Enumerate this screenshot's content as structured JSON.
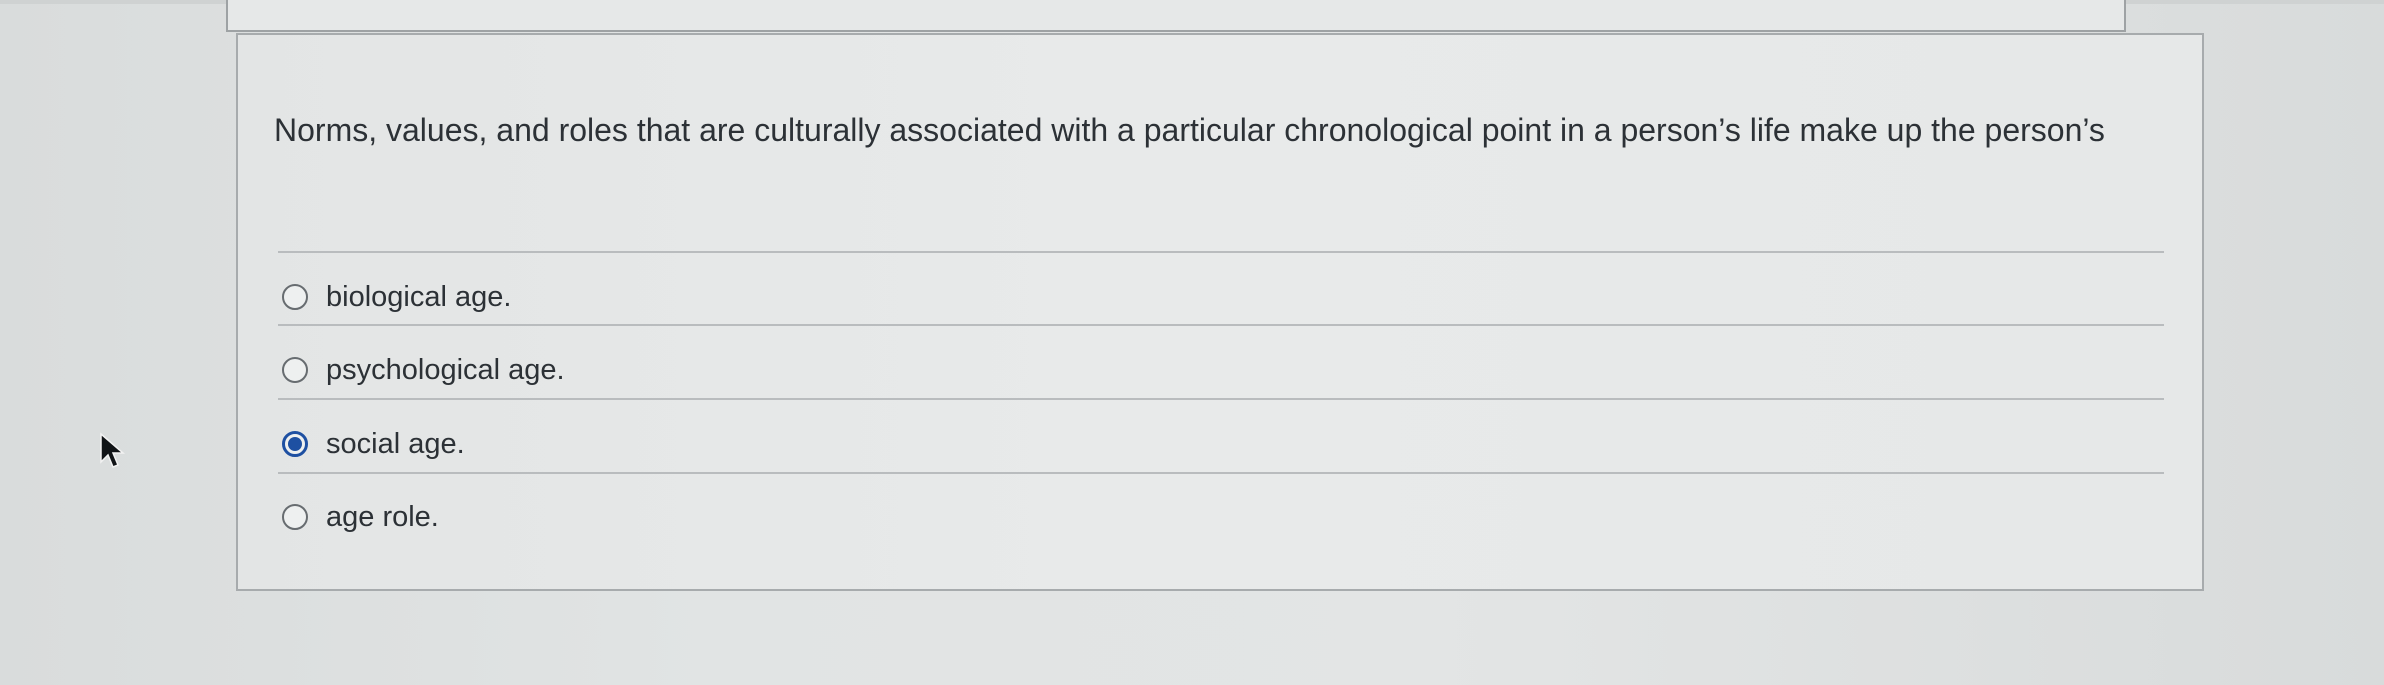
{
  "question": {
    "text": "Norms, values, and roles that are culturally associated with a particular chronological point in a person’s life make up the person’s"
  },
  "choices": [
    {
      "label": "biological age.",
      "selected": false
    },
    {
      "label": "psychological age.",
      "selected": false
    },
    {
      "label": "social age.",
      "selected": true
    },
    {
      "label": "age role.",
      "selected": false
    }
  ],
  "colors": {
    "accent": "#1e50a2",
    "text": "#2c3136",
    "border": "#a7abad"
  },
  "icons": {
    "cursor": "mouse-pointer-icon",
    "radio": "radio-button-icon"
  }
}
